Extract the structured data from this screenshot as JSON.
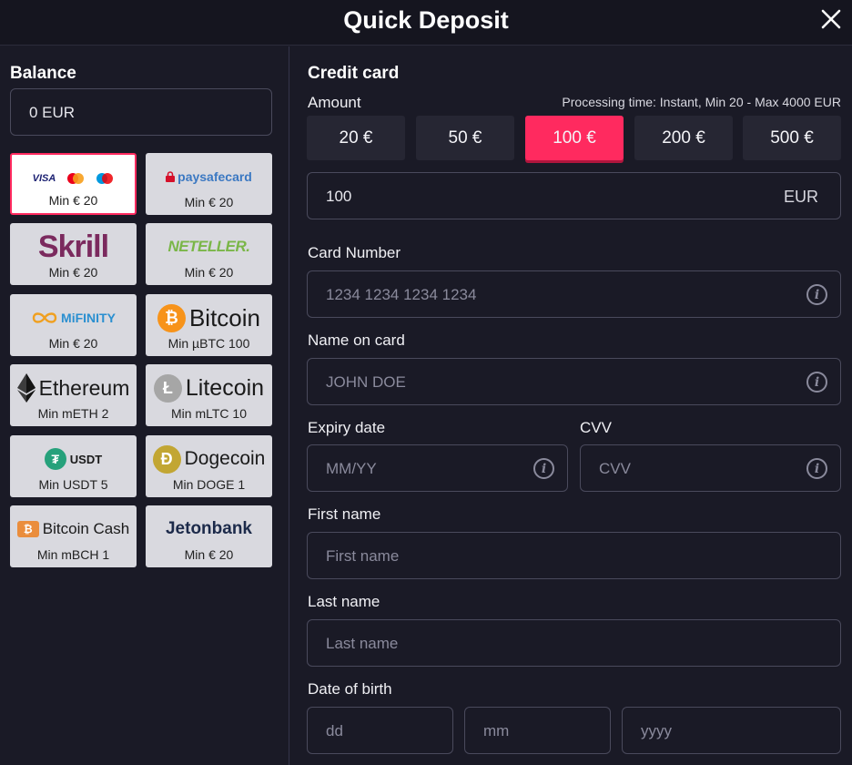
{
  "header": {
    "title": "Quick Deposit"
  },
  "balance": {
    "label": "Balance",
    "value": "0 EUR"
  },
  "methods": [
    {
      "logo_text": "",
      "min": "Min € 20",
      "selected": true
    },
    {
      "logo_text": "paysafecard",
      "min": "Min € 20"
    },
    {
      "logo_text": "Skrill",
      "min": "Min € 20"
    },
    {
      "logo_text": "NETELLER.",
      "min": "Min € 20"
    },
    {
      "logo_text": "MiFINITY",
      "min": "Min € 20"
    },
    {
      "logo_text": "Bitcoin",
      "min": "Min µBTC 100"
    },
    {
      "logo_text": "Ethereum",
      "min": "Min mETH 2"
    },
    {
      "logo_text": "Litecoin",
      "min": "Min mLTC 10"
    },
    {
      "logo_text": "USDT",
      "min": "Min USDT 5"
    },
    {
      "logo_text": "Dogecoin",
      "min": "Min DOGE 1"
    },
    {
      "logo_text": "Bitcoin Cash",
      "min": "Min mBCH 1"
    },
    {
      "logo_text": "Jetonbank",
      "min": "Min € 20"
    }
  ],
  "visa_text": "VISA",
  "form": {
    "title": "Credit card",
    "amount_label": "Amount",
    "processing": "Processing time: Instant, Min 20 - Max 4000 EUR",
    "amounts": [
      "20 €",
      "50 €",
      "100 €",
      "200 €",
      "500 €"
    ],
    "selected_amount_index": 2,
    "amount_value": "100",
    "currency": "EUR",
    "card_number_label": "Card Number",
    "card_number_placeholder": "1234 1234 1234 1234",
    "name_label": "Name on card",
    "name_placeholder": "JOHN DOE",
    "expiry_label": "Expiry date",
    "expiry_placeholder": "MM/YY",
    "cvv_label": "CVV",
    "cvv_placeholder": "CVV",
    "first_name_label": "First name",
    "first_name_placeholder": "First name",
    "last_name_label": "Last name",
    "last_name_placeholder": "Last name",
    "dob_label": "Date of birth",
    "dob_day_placeholder": "dd",
    "dob_month_placeholder": "mm",
    "dob_year_placeholder": "yyyy",
    "info_glyph": "i"
  },
  "colors": {
    "accent": "#ff2a5f",
    "background": "#1a1a26",
    "tile": "#d9d9df"
  }
}
